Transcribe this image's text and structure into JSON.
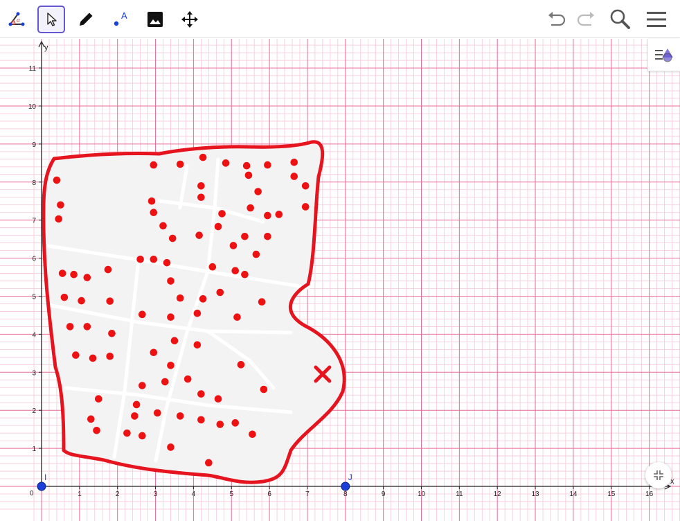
{
  "toolbar": {
    "tools": [
      {
        "name": "angle-tool",
        "selected": false
      },
      {
        "name": "move-tool",
        "selected": true
      },
      {
        "name": "pen-tool",
        "selected": false
      },
      {
        "name": "text-tool",
        "selected": false,
        "label": "A"
      },
      {
        "name": "image-tool",
        "selected": false
      },
      {
        "name": "move-graphics-view-tool",
        "selected": false
      }
    ],
    "right": [
      "undo-icon",
      "redo-icon",
      "search-icon",
      "menu-icon"
    ]
  },
  "axes": {
    "x_label": "x",
    "y_label": "y",
    "origin_label": "0",
    "x_ticks": [
      "1",
      "2",
      "3",
      "4",
      "5",
      "6",
      "7",
      "8",
      "9",
      "10",
      "11",
      "12",
      "13",
      "14",
      "15",
      "16"
    ],
    "y_ticks": [
      "1",
      "2",
      "3",
      "4",
      "5",
      "6",
      "7",
      "8",
      "9",
      "10",
      "11"
    ]
  },
  "points": [
    {
      "name": "I",
      "x": 0,
      "y": 0,
      "color": "#1a3fd9"
    },
    {
      "name": "J",
      "x": 8,
      "y": 0,
      "color": "#1a3fd9"
    }
  ],
  "marker": {
    "type": "cross",
    "x": 7.4,
    "y": 2.95,
    "color": "#e6141e"
  },
  "colors": {
    "grid_minor": "#f6c6d8",
    "grid_major": "#e96b97",
    "outline": "#e6141e",
    "dots": "#ee1111",
    "map_fill": "#f3f3f4"
  },
  "dots": [
    [
      0.4,
      8.05
    ],
    [
      0.5,
      7.4
    ],
    [
      0.45,
      7.03
    ],
    [
      2.95,
      8.45
    ],
    [
      3.65,
      8.47
    ],
    [
      4.25,
      8.65
    ],
    [
      4.85,
      8.5
    ],
    [
      5.4,
      8.43
    ],
    [
      5.95,
      8.45
    ],
    [
      6.65,
      8.52
    ],
    [
      5.45,
      8.18
    ],
    [
      6.65,
      8.15
    ],
    [
      4.2,
      7.9
    ],
    [
      6.95,
      7.9
    ],
    [
      5.7,
      7.75
    ],
    [
      2.9,
      7.5
    ],
    [
      4.2,
      7.6
    ],
    [
      2.95,
      7.2
    ],
    [
      5.5,
      7.32
    ],
    [
      6.25,
      7.15
    ],
    [
      6.95,
      7.35
    ],
    [
      4.75,
      7.17
    ],
    [
      5.95,
      7.12
    ],
    [
      3.2,
      6.85
    ],
    [
      4.65,
      6.83
    ],
    [
      3.45,
      6.52
    ],
    [
      4.15,
      6.6
    ],
    [
      5.35,
      6.57
    ],
    [
      5.95,
      6.57
    ],
    [
      5.05,
      6.33
    ],
    [
      5.65,
      6.1
    ],
    [
      2.6,
      5.97
    ],
    [
      2.95,
      5.97
    ],
    [
      3.3,
      5.88
    ],
    [
      4.5,
      5.77
    ],
    [
      5.1,
      5.67
    ],
    [
      5.35,
      5.57
    ],
    [
      1.75,
      5.7
    ],
    [
      0.55,
      5.6
    ],
    [
      0.85,
      5.57
    ],
    [
      1.2,
      5.49
    ],
    [
      3.4,
      5.4
    ],
    [
      0.6,
      4.97
    ],
    [
      1.05,
      4.88
    ],
    [
      1.8,
      4.87
    ],
    [
      3.65,
      4.95
    ],
    [
      4.25,
      4.93
    ],
    [
      4.7,
      5.1
    ],
    [
      5.8,
      4.85
    ],
    [
      2.65,
      4.52
    ],
    [
      3.4,
      4.45
    ],
    [
      4.1,
      4.55
    ],
    [
      5.15,
      4.45
    ],
    [
      0.75,
      4.2
    ],
    [
      1.2,
      4.2
    ],
    [
      1.85,
      4.02
    ],
    [
      3.5,
      3.83
    ],
    [
      4.1,
      3.72
    ],
    [
      0.9,
      3.45
    ],
    [
      1.35,
      3.37
    ],
    [
      1.8,
      3.42
    ],
    [
      2.95,
      3.52
    ],
    [
      3.4,
      3.18
    ],
    [
      5.25,
      3.2
    ],
    [
      2.65,
      2.65
    ],
    [
      3.25,
      2.75
    ],
    [
      3.85,
      2.82
    ],
    [
      5.85,
      2.55
    ],
    [
      1.5,
      2.3
    ],
    [
      2.5,
      2.15
    ],
    [
      4.2,
      2.43
    ],
    [
      4.65,
      2.3
    ],
    [
      1.3,
      1.77
    ],
    [
      2.45,
      1.85
    ],
    [
      3.05,
      1.93
    ],
    [
      3.65,
      1.85
    ],
    [
      4.2,
      1.75
    ],
    [
      4.7,
      1.63
    ],
    [
      5.1,
      1.67
    ],
    [
      1.45,
      1.47
    ],
    [
      2.25,
      1.4
    ],
    [
      2.65,
      1.33
    ],
    [
      5.55,
      1.37
    ],
    [
      3.4,
      1.03
    ],
    [
      4.4,
      0.62
    ]
  ]
}
